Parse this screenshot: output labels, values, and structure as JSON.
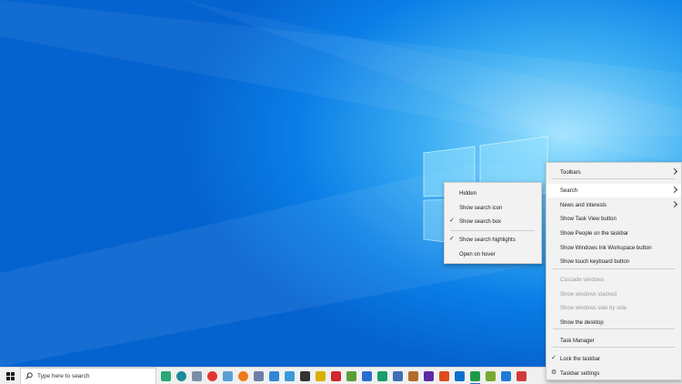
{
  "taskbar": {
    "search_placeholder": "Type here to search"
  },
  "context_menu": {
    "items": [
      {
        "label": "Toolbars",
        "submenu": true
      },
      {
        "label": "Search",
        "submenu": true,
        "highlighted": true
      },
      {
        "label": "News and interests",
        "submenu": true
      },
      {
        "label": "Show Task View button"
      },
      {
        "label": "Show People on the taskbar"
      },
      {
        "label": "Show Windows Ink Workspace button"
      },
      {
        "label": "Show touch keyboard button"
      },
      {
        "label": "Cascade windows",
        "disabled": true
      },
      {
        "label": "Show windows stacked",
        "disabled": true
      },
      {
        "label": "Show windows side by side",
        "disabled": true
      },
      {
        "label": "Show the desktop"
      },
      {
        "label": "Task Manager"
      },
      {
        "label": "Lock the taskbar",
        "checked": true
      },
      {
        "label": "Taskbar settings",
        "icon": "gear-icon"
      }
    ]
  },
  "search_submenu": {
    "items": [
      {
        "label": "Hidden"
      },
      {
        "label": "Show search icon"
      },
      {
        "label": "Show search box",
        "checked": true
      },
      {
        "label": "Show search highlights",
        "checked": true
      },
      {
        "label": "Open on hover"
      }
    ]
  },
  "taskbar_icons": [
    {
      "name": "feather-app-icon",
      "color": "#2aa876"
    },
    {
      "name": "globe-app-icon",
      "color": "#1c8c9c"
    },
    {
      "name": "mail-app-icon",
      "color": "#7a8fa6"
    },
    {
      "name": "chrome-icon",
      "color": "#e3342f"
    },
    {
      "name": "app-icon",
      "color": "#5aa0d6"
    },
    {
      "name": "firefox-icon",
      "color": "#f07a1a"
    },
    {
      "name": "app-icon",
      "color": "#6d7fa8"
    },
    {
      "name": "app-icon",
      "color": "#2f87d6"
    },
    {
      "name": "app-icon",
      "color": "#3a9bd8"
    },
    {
      "name": "checkmark-app-icon",
      "color": "#333333"
    },
    {
      "name": "app-icon",
      "color": "#d8b000"
    },
    {
      "name": "lightning-app-icon",
      "color": "#d0262d"
    },
    {
      "name": "app-icon",
      "color": "#5a9e3c"
    },
    {
      "name": "app-icon",
      "color": "#2a6dd1"
    },
    {
      "name": "app-icon",
      "color": "#1b9e6a"
    },
    {
      "name": "app-icon",
      "color": "#3d6fb5"
    },
    {
      "name": "app-icon",
      "color": "#b56a2a"
    },
    {
      "name": "app-icon",
      "color": "#5b2aa8"
    },
    {
      "name": "brave-icon",
      "color": "#e04a1d"
    },
    {
      "name": "app-icon",
      "color": "#0f6fd0"
    },
    {
      "name": "app-icon",
      "color": "#1e9b4a"
    },
    {
      "name": "app-icon",
      "color": "#7aa830"
    },
    {
      "name": "app-icon",
      "color": "#1e7bd8"
    },
    {
      "name": "app-icon",
      "color": "#d23a3a"
    }
  ]
}
